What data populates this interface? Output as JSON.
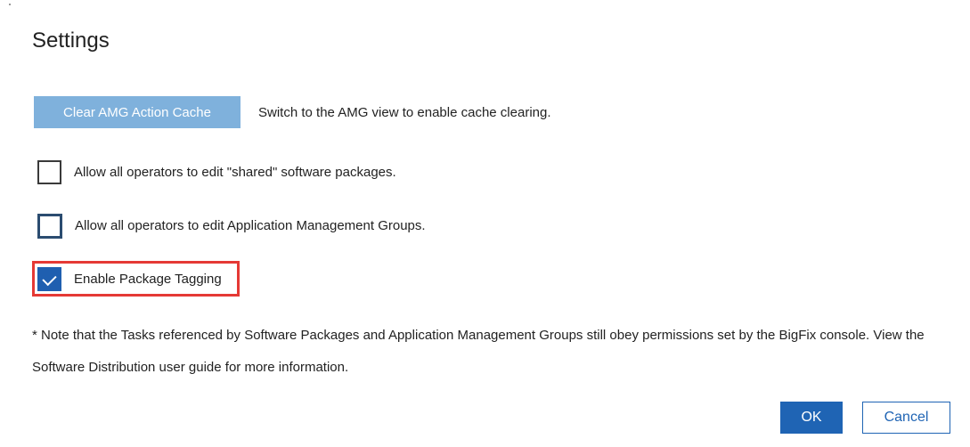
{
  "dialog": {
    "title": "Settings"
  },
  "cache": {
    "clear_button_label": "Clear AMG Action Cache",
    "hint": "Switch to the AMG view to enable cache clearing."
  },
  "options": [
    {
      "label": "Allow all operators to edit \"shared\" software packages.",
      "checked": false
    },
    {
      "label": "Allow all operators to edit Application Management Groups.",
      "checked": false
    },
    {
      "label": "Enable Package Tagging",
      "checked": true
    }
  ],
  "note": "* Note that the Tasks referenced by Software Packages and Application Management Groups still obey permissions set by the BigFix console. View the Software Distribution user guide for more information.",
  "footer": {
    "ok_label": "OK",
    "cancel_label": "Cancel"
  },
  "colors": {
    "primary": "#1f64b4",
    "disabled_button": "#7fb1dc",
    "highlight": "#e53935"
  }
}
